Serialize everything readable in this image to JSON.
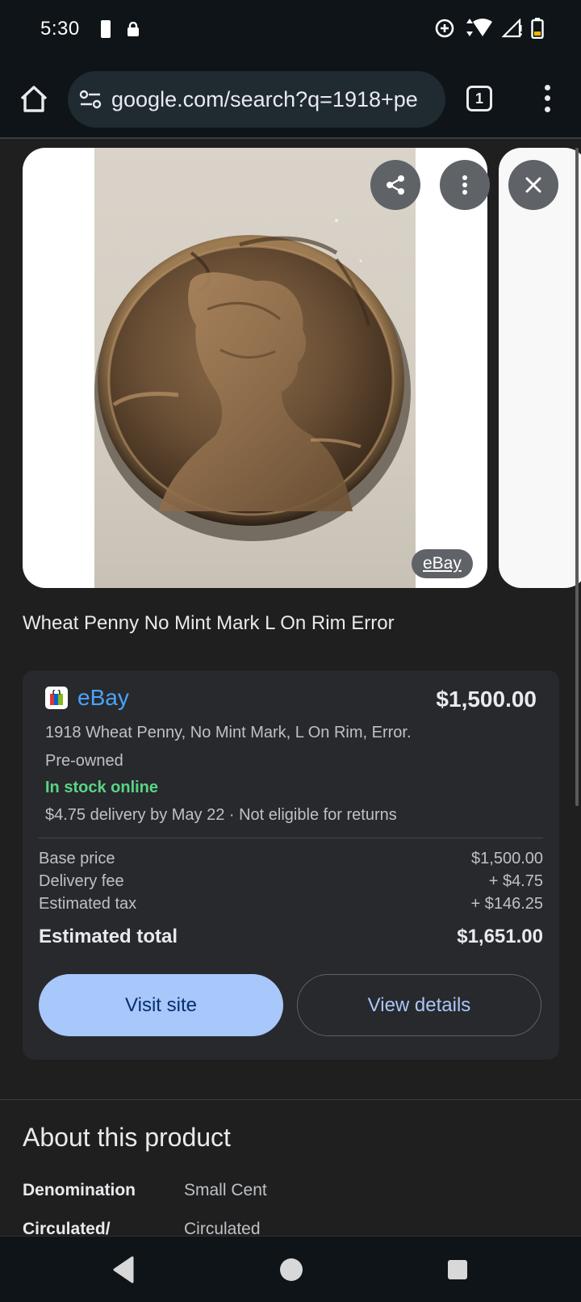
{
  "status_bar": {
    "time": "5:30"
  },
  "toolbar": {
    "url": "google.com/search?q=1918+pe",
    "tab_count": "1"
  },
  "image": {
    "source_badge": "eBay"
  },
  "product": {
    "title": "Wheat Penny No Mint Mark L On Rim Error"
  },
  "offer": {
    "store": "eBay",
    "price": "$1,500.00",
    "description": "1918 Wheat Penny, No Mint Mark, L On Rim, Error.",
    "condition": "Pre-owned",
    "stock": "In stock online",
    "delivery": "$4.75 delivery by May 22 · Not eligible for returns",
    "costs": [
      {
        "label": "Base price",
        "value": "$1,500.00"
      },
      {
        "label": "Delivery fee",
        "value": "+ $4.75"
      },
      {
        "label": "Estimated tax",
        "value": "+ $146.25"
      }
    ],
    "total_label": "Estimated total",
    "total_value": "$1,651.00",
    "visit_label": "Visit site",
    "details_label": "View details"
  },
  "about": {
    "title": "About this product",
    "attributes": [
      {
        "key": "Denomination",
        "value": "Small Cent"
      },
      {
        "key": "Circulated/",
        "value": "Circulated"
      }
    ]
  },
  "colors": {
    "background": "#1f1f1f",
    "accent_button": "#a8c7fa",
    "store_link": "#4aa3ff",
    "in_stock": "#5bd485"
  }
}
